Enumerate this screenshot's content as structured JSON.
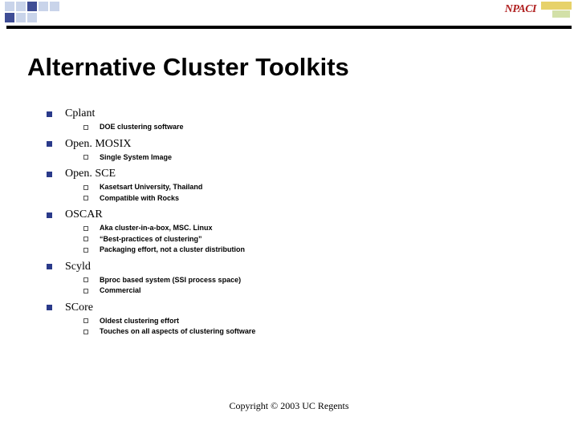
{
  "title": "Alternative Cluster Toolkits",
  "logo_text": "NPACI",
  "items": [
    {
      "label": "Cplant",
      "sub": [
        "DOE clustering software"
      ]
    },
    {
      "label": "Open. MOSIX",
      "sub": [
        "Single System Image"
      ]
    },
    {
      "label": "Open. SCE",
      "sub": [
        "Kasetsart University, Thailand",
        "Compatible with Rocks"
      ]
    },
    {
      "label": "OSCAR",
      "sub": [
        "Aka cluster-in-a-box, MSC. Linux",
        "“Best-practices of clustering”",
        "Packaging effort, not a cluster distribution"
      ]
    },
    {
      "label": "Scyld",
      "sub": [
        "Bproc based system (SSI process space)",
        "Commercial"
      ]
    },
    {
      "label": "SCore",
      "sub": [
        "Oldest clustering effort",
        "Touches on all aspects of clustering software"
      ]
    }
  ],
  "footer": "Copyright © 2003 UC Regents"
}
